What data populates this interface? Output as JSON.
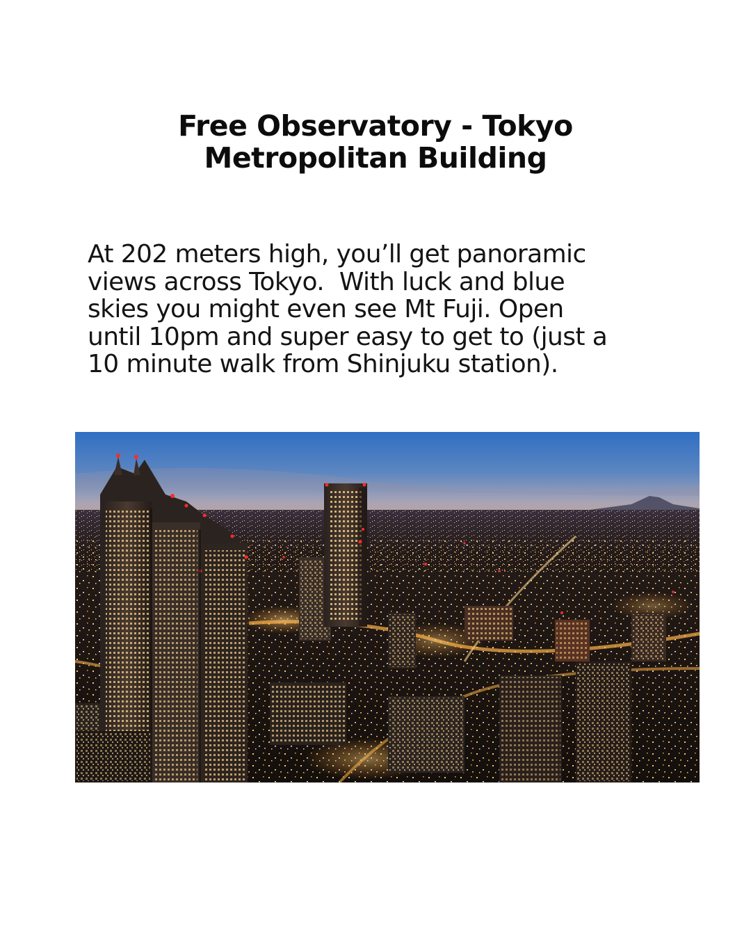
{
  "title": {
    "line1": "Free Observatory - Tokyo",
    "line2": "Metropolitan Building"
  },
  "body": {
    "lines": [
      "At 202 meters high, you’ll get panoramic",
      "views across Tokyo.  With luck and blue",
      "skies you might even see Mt Fuji. Open",
      "until 10pm and super easy to get to (just a",
      "10 minute walk from Shinjuku station)."
    ]
  },
  "photo": {
    "sky_top": "#2f6fc4",
    "sky_horizon": "#c9a58a",
    "city_dark": "#140f0c",
    "light_warm": "#ffb347",
    "light_white": "#fff4d6",
    "beacon_red": "#ff2a2a"
  }
}
